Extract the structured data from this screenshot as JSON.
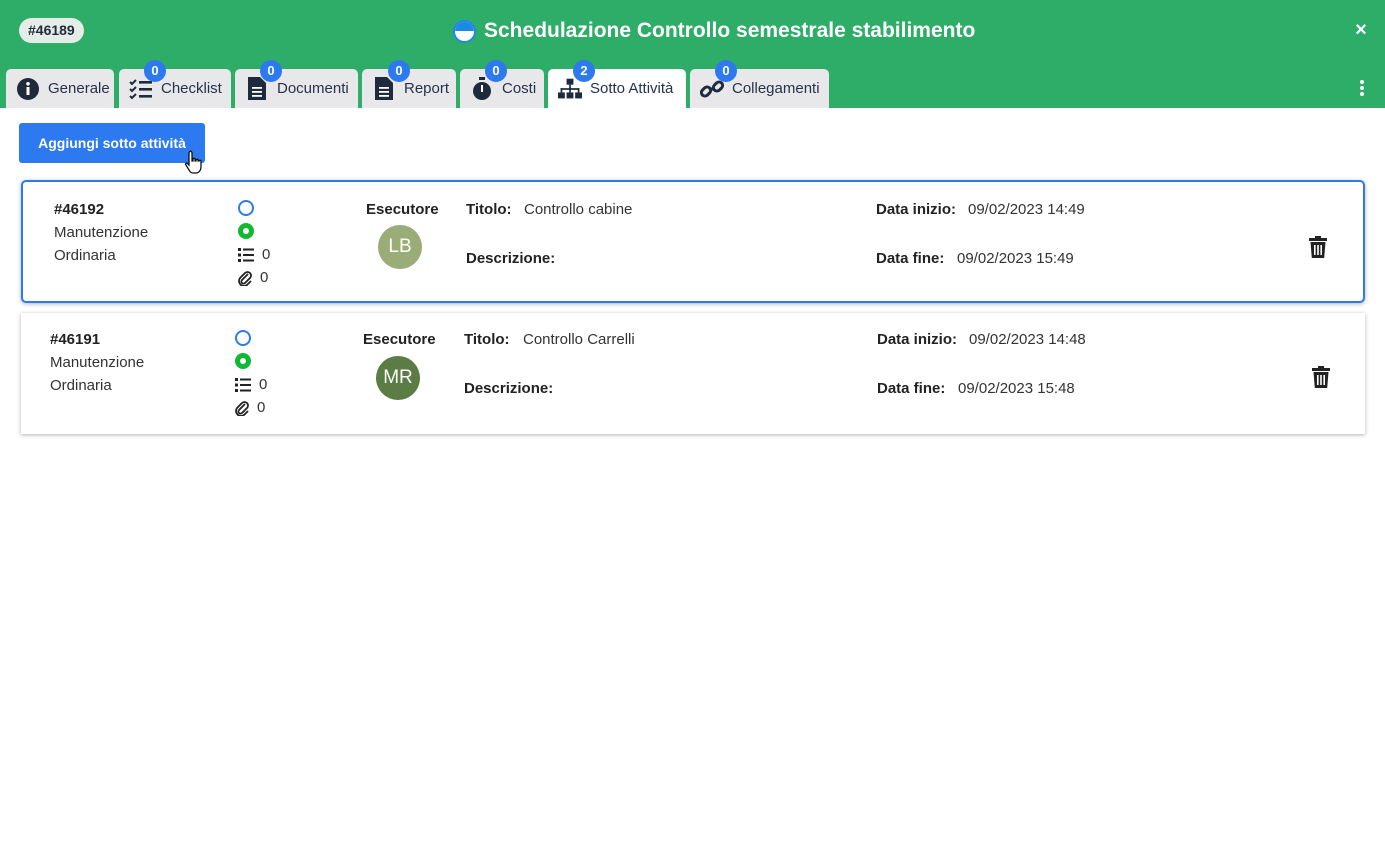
{
  "header": {
    "id_badge": "#46189",
    "title": "Schedulazione Controllo semestrale stabilimento",
    "close_label": "×",
    "bg_color": "#2ead68"
  },
  "tabs": [
    {
      "label": "Generale",
      "icon": "info-circle-icon",
      "count": null,
      "active": false
    },
    {
      "label": "Checklist",
      "icon": "checklist-icon",
      "count": "0",
      "active": false
    },
    {
      "label": "Documenti",
      "icon": "document-icon",
      "count": "0",
      "active": false
    },
    {
      "label": "Report",
      "icon": "report-icon",
      "count": "0",
      "active": false
    },
    {
      "label": "Costi",
      "icon": "stopwatch-icon",
      "count": "0",
      "active": false
    },
    {
      "label": "Sotto Attività",
      "icon": "sitemap-icon",
      "count": "2",
      "active": true
    },
    {
      "label": "Collegamenti",
      "icon": "link-icon",
      "count": "0",
      "active": false
    }
  ],
  "main": {
    "add_button": "Aggiungi sotto attività",
    "subtasks": [
      {
        "id": "#46192",
        "type": "Manutenzione",
        "category": "Ordinaria",
        "checklist_count": "0",
        "attachments_count": "0",
        "executor_label": "Esecutore",
        "executor_initials": "LB",
        "executor_color": "#9aac78",
        "title_label": "Titolo:",
        "title": "Controllo cabine",
        "description_label": "Descrizione:",
        "description": "",
        "start_label": "Data inizio:",
        "start": "09/02/2023 14:49",
        "end_label": "Data fine:",
        "end": "09/02/2023 15:49"
      },
      {
        "id": "#46191",
        "type": "Manutenzione",
        "category": "Ordinaria",
        "checklist_count": "0",
        "attachments_count": "0",
        "executor_label": "Esecutore",
        "executor_initials": "MR",
        "executor_color": "#5b7c45",
        "title_label": "Titolo:",
        "title": "Controllo Carrelli",
        "description_label": "Descrizione:",
        "description": "",
        "start_label": "Data inizio:",
        "start": "09/02/2023 14:48",
        "end_label": "Data fine:",
        "end": "09/02/2023 15:48"
      }
    ]
  }
}
